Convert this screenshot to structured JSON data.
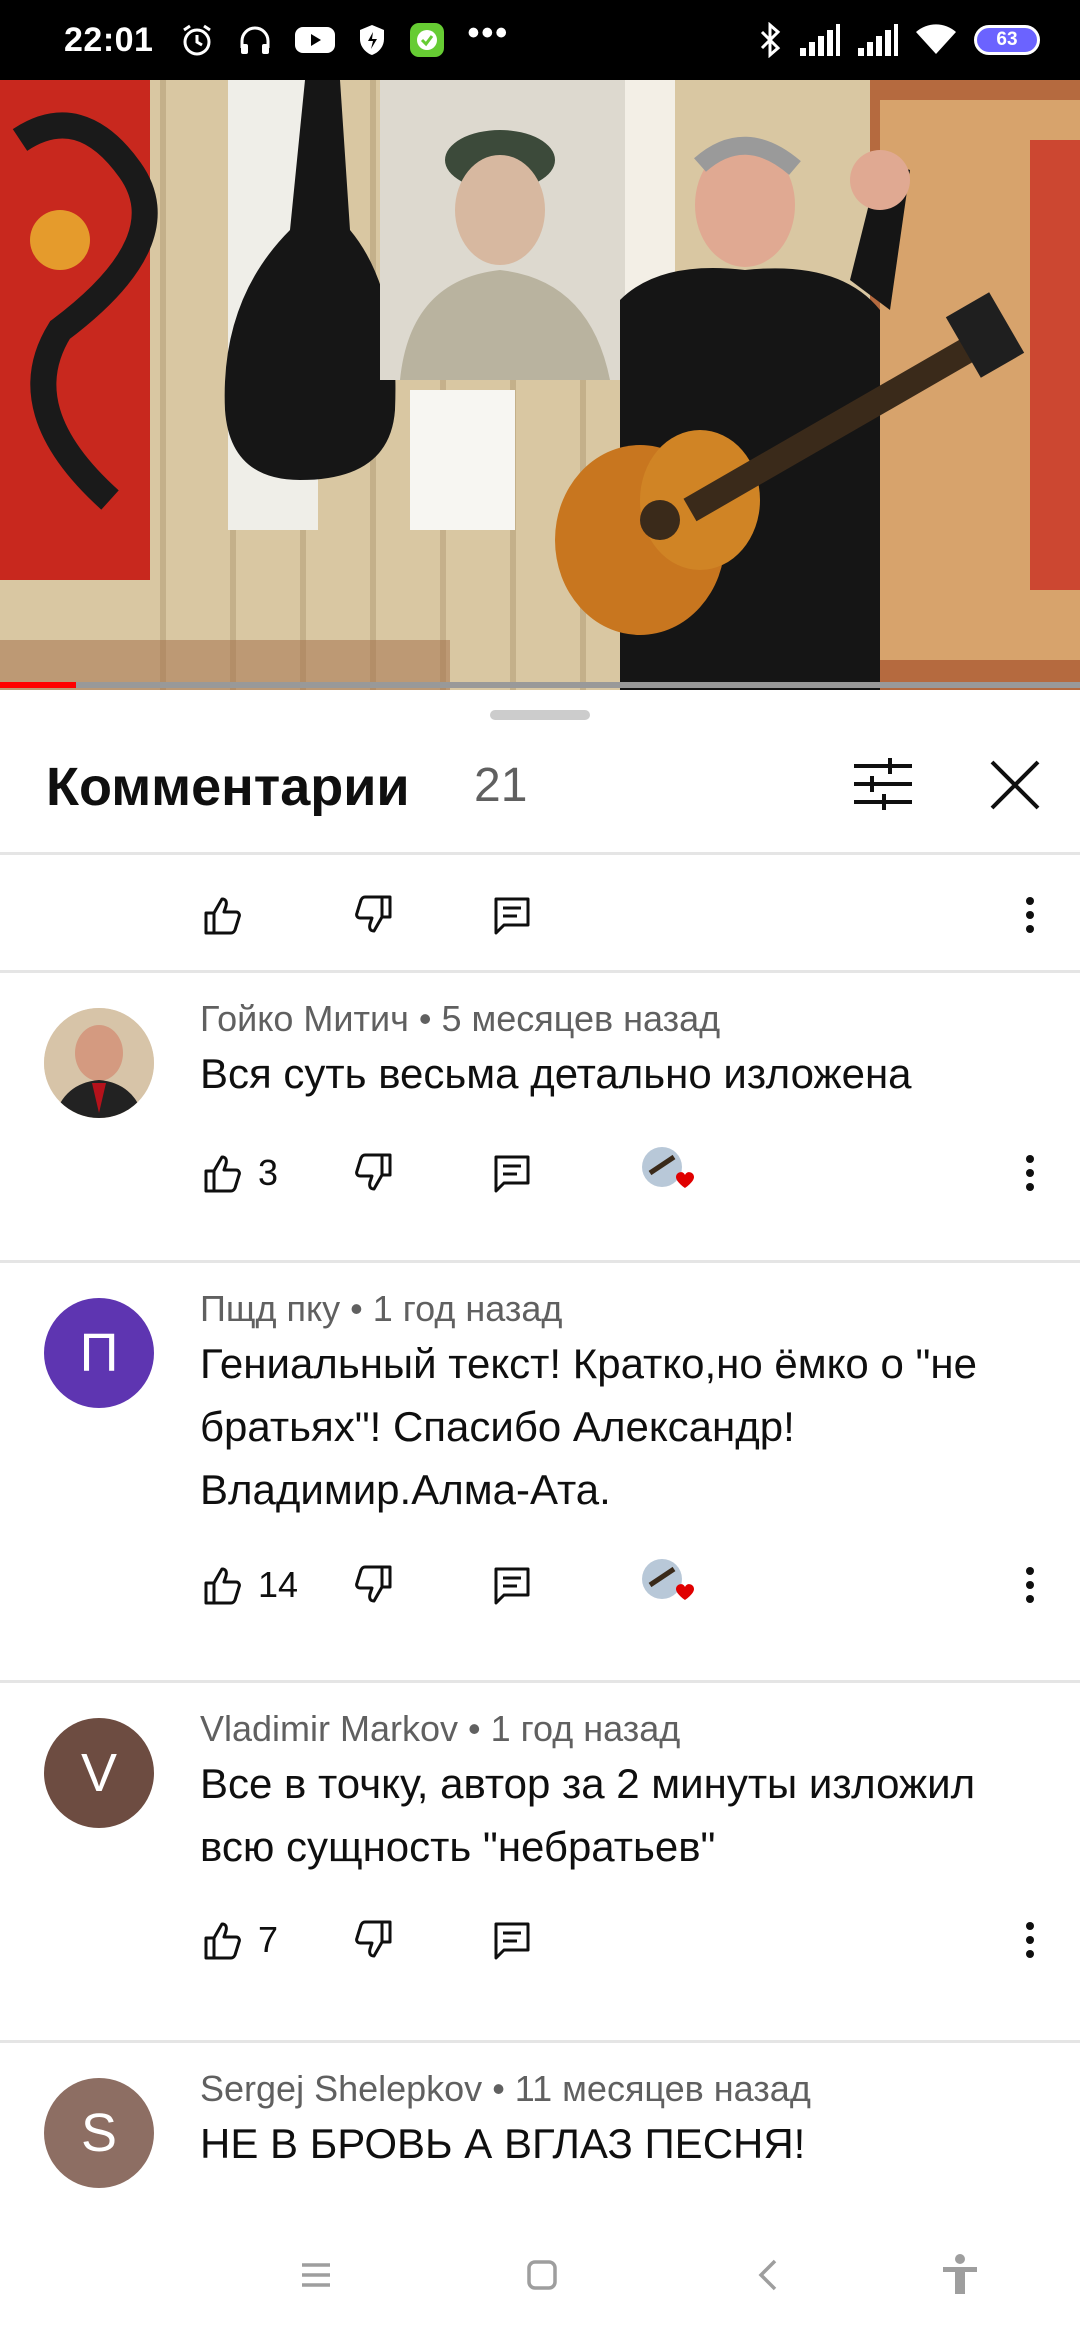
{
  "status_bar": {
    "time": "22:01",
    "left_icons": [
      "alarm-icon",
      "headphones-icon",
      "youtube-icon",
      "shield-icon",
      "messenger-icon"
    ],
    "more": "•••",
    "right_icons": [
      "bluetooth-icon",
      "signal-icon",
      "signal-icon",
      "wifi-icon"
    ],
    "battery": "63"
  },
  "video": {
    "progress": 0.07,
    "colors": {
      "progress": "#ff0000"
    }
  },
  "comments_panel": {
    "title": "Комментарии",
    "count": "21"
  },
  "comments": [
    {
      "author": "Гойко Митич",
      "time": "5 месяцев назад",
      "text": "Вся суть весьма детально изложена",
      "likes": "3",
      "hearted": true
    },
    {
      "author": "Пщд пку",
      "time": "1 год назад",
      "text": "Гениальный текст! Кратко,но ёмко о \"не братьях\"! Спасибо Александр! Владимир.Алма-Ата.",
      "likes": "14",
      "hearted": true,
      "avatar_letter": "П",
      "avatar_color": "#5e35b1"
    },
    {
      "author": "Vladimir Markov",
      "time": "1 год назад",
      "text": "Все в точку, автор за 2 минуты изложил всю сущность \"небратьев\"",
      "likes": "7",
      "hearted": false,
      "avatar_letter": "V",
      "avatar_color": "#6d4c41"
    },
    {
      "author": "Sergej Shelepkov",
      "time": "11 месяцев назад",
      "text": "НЕ В БРОВЬ А ВГЛАЗ ПЕСНЯ!",
      "avatar_letter": "S",
      "avatar_color": "#8d6e63"
    }
  ],
  "separator": " • ",
  "nav_bar": {
    "icons": [
      "menu-icon",
      "home-icon",
      "back-icon",
      "accessibility-icon"
    ]
  }
}
